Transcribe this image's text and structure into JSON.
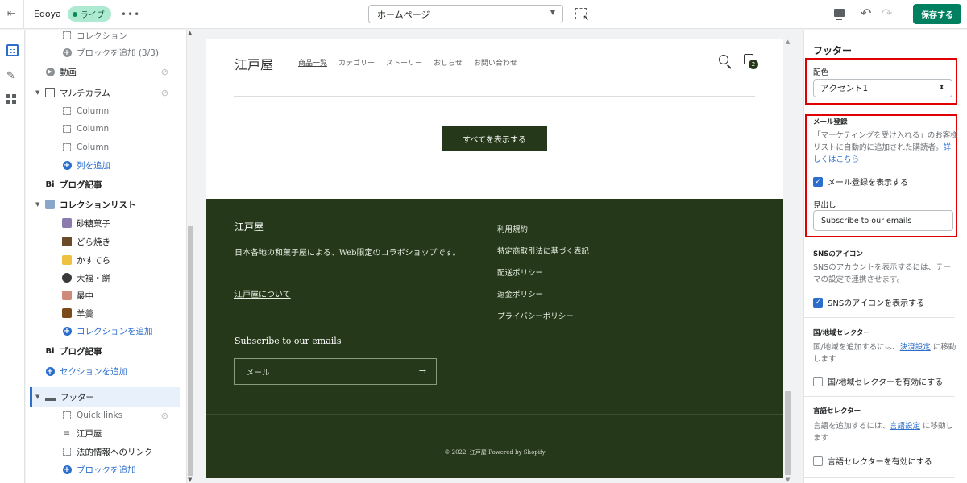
{
  "topbar": {
    "exit_icon": "exit-icon",
    "store": "Edoya",
    "live": "ライブ",
    "more": "•••",
    "page_select": "ホームページ",
    "save": "保存する"
  },
  "sidebar": {
    "items": [
      {
        "label": "コレクション",
        "kind": "child"
      },
      {
        "label": "ブロックを追加 (3/3)",
        "kind": "add-gray"
      },
      {
        "label": "動画",
        "kind": "section"
      },
      {
        "label": "マルチカラム",
        "kind": "section-open"
      },
      {
        "label": "Column",
        "kind": "child"
      },
      {
        "label": "Column",
        "kind": "child"
      },
      {
        "label": "Column",
        "kind": "child"
      },
      {
        "label": "列を追加",
        "kind": "add"
      },
      {
        "label": "ブログ記事",
        "kind": "section-bold"
      },
      {
        "label": "コレクションリスト",
        "kind": "section-open-bold"
      },
      {
        "label": "砂糖菓子",
        "kind": "thumb",
        "color": "#8a7ab0"
      },
      {
        "label": "どら焼き",
        "kind": "thumb",
        "color": "#6b4a2a"
      },
      {
        "label": "かすてら",
        "kind": "thumb",
        "color": "#f0c040"
      },
      {
        "label": "大福・餅",
        "kind": "thumb",
        "color": "#3a3a3a"
      },
      {
        "label": "最中",
        "kind": "thumb",
        "color": "#d08a7a"
      },
      {
        "label": "羊羹",
        "kind": "thumb",
        "color": "#7a4a1a"
      },
      {
        "label": "コレクションを追加",
        "kind": "add"
      },
      {
        "label": "ブログ記事",
        "kind": "section-bold"
      },
      {
        "label": "セクションを追加",
        "kind": "add-section"
      },
      {
        "label": "フッター",
        "kind": "footer-selected"
      },
      {
        "label": "Quick links",
        "kind": "child"
      },
      {
        "label": "江戸屋",
        "kind": "text"
      },
      {
        "label": "法的情報へのリンク",
        "kind": "child"
      },
      {
        "label": "ブロックを追加",
        "kind": "add"
      }
    ]
  },
  "preview": {
    "logo": "江戸屋",
    "nav": [
      "商品一覧",
      "カテゴリー",
      "ストーリー",
      "おしらせ",
      "お問い合わせ"
    ],
    "cart_count": "2",
    "view_all": "すべてを表示する",
    "footer": {
      "title": "江戸屋",
      "description": "日本各地の和菓子屋による、Web限定のコラボショップです。",
      "about": "江戸屋について",
      "links": [
        "利用規約",
        "特定商取引法に基づく表記",
        "配送ポリシー",
        "返金ポリシー",
        "プライバシーポリシー"
      ],
      "subscribe_title": "Subscribe to our emails",
      "email_placeholder": "メール",
      "copyright": "© 2022, 江戸屋 Powered by Shopify"
    }
  },
  "right_panel": {
    "title": "フッター",
    "color_label": "配色",
    "color_value": "アクセント1",
    "email_heading": "メール登録",
    "email_desc": "「マーケティングを受け入れる」のお客様リストに自動的に追加された購読者。",
    "learn_more": "詳しくはこちら",
    "email_checkbox": "メール登録を表示する",
    "heading_label": "見出し",
    "heading_value": "Subscribe to our emails",
    "sns_heading": "SNSのアイコン",
    "sns_desc": "SNSのアカウントを表示するには、テーマの設定で連携させます。",
    "sns_checkbox": "SNSのアイコンを表示する",
    "country_heading": "国/地域セレクター",
    "country_desc_pre": "国/地域を追加するには、",
    "country_link": "決済設定",
    "country_desc_post": " に移動します",
    "country_checkbox": "国/地域セレクターを有効にする",
    "lang_heading": "言語セレクター",
    "lang_desc_pre": "言語を追加するには、",
    "lang_link": "言語設定",
    "lang_desc_post": " に移動します",
    "lang_checkbox": "言語セレクターを有効にする"
  },
  "colors": {
    "accent": "#2c6ecb",
    "save": "#008060",
    "footer_bg": "#25391a",
    "highlight": "#e00000"
  }
}
